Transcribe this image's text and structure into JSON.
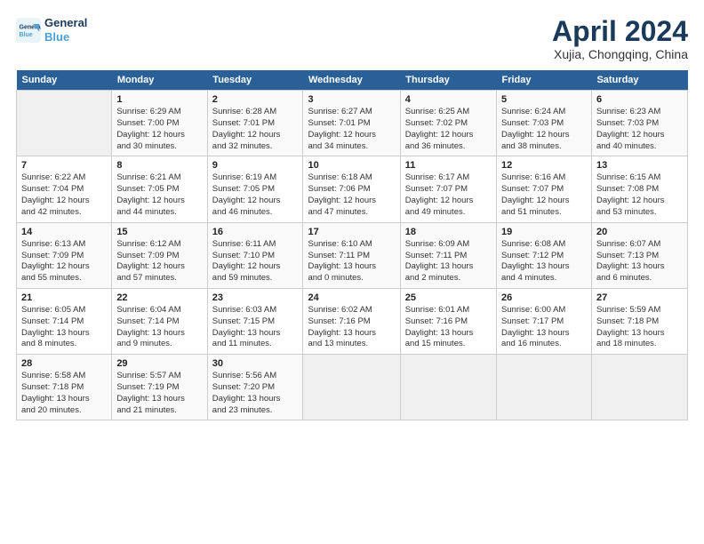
{
  "header": {
    "logo_line1": "General",
    "logo_line2": "Blue",
    "month_title": "April 2024",
    "location": "Xujia, Chongqing, China"
  },
  "weekdays": [
    "Sunday",
    "Monday",
    "Tuesday",
    "Wednesday",
    "Thursday",
    "Friday",
    "Saturday"
  ],
  "weeks": [
    [
      {
        "day": "",
        "info": ""
      },
      {
        "day": "1",
        "info": "Sunrise: 6:29 AM\nSunset: 7:00 PM\nDaylight: 12 hours\nand 30 minutes."
      },
      {
        "day": "2",
        "info": "Sunrise: 6:28 AM\nSunset: 7:01 PM\nDaylight: 12 hours\nand 32 minutes."
      },
      {
        "day": "3",
        "info": "Sunrise: 6:27 AM\nSunset: 7:01 PM\nDaylight: 12 hours\nand 34 minutes."
      },
      {
        "day": "4",
        "info": "Sunrise: 6:25 AM\nSunset: 7:02 PM\nDaylight: 12 hours\nand 36 minutes."
      },
      {
        "day": "5",
        "info": "Sunrise: 6:24 AM\nSunset: 7:03 PM\nDaylight: 12 hours\nand 38 minutes."
      },
      {
        "day": "6",
        "info": "Sunrise: 6:23 AM\nSunset: 7:03 PM\nDaylight: 12 hours\nand 40 minutes."
      }
    ],
    [
      {
        "day": "7",
        "info": "Sunrise: 6:22 AM\nSunset: 7:04 PM\nDaylight: 12 hours\nand 42 minutes."
      },
      {
        "day": "8",
        "info": "Sunrise: 6:21 AM\nSunset: 7:05 PM\nDaylight: 12 hours\nand 44 minutes."
      },
      {
        "day": "9",
        "info": "Sunrise: 6:19 AM\nSunset: 7:05 PM\nDaylight: 12 hours\nand 46 minutes."
      },
      {
        "day": "10",
        "info": "Sunrise: 6:18 AM\nSunset: 7:06 PM\nDaylight: 12 hours\nand 47 minutes."
      },
      {
        "day": "11",
        "info": "Sunrise: 6:17 AM\nSunset: 7:07 PM\nDaylight: 12 hours\nand 49 minutes."
      },
      {
        "day": "12",
        "info": "Sunrise: 6:16 AM\nSunset: 7:07 PM\nDaylight: 12 hours\nand 51 minutes."
      },
      {
        "day": "13",
        "info": "Sunrise: 6:15 AM\nSunset: 7:08 PM\nDaylight: 12 hours\nand 53 minutes."
      }
    ],
    [
      {
        "day": "14",
        "info": "Sunrise: 6:13 AM\nSunset: 7:09 PM\nDaylight: 12 hours\nand 55 minutes."
      },
      {
        "day": "15",
        "info": "Sunrise: 6:12 AM\nSunset: 7:09 PM\nDaylight: 12 hours\nand 57 minutes."
      },
      {
        "day": "16",
        "info": "Sunrise: 6:11 AM\nSunset: 7:10 PM\nDaylight: 12 hours\nand 59 minutes."
      },
      {
        "day": "17",
        "info": "Sunrise: 6:10 AM\nSunset: 7:11 PM\nDaylight: 13 hours\nand 0 minutes."
      },
      {
        "day": "18",
        "info": "Sunrise: 6:09 AM\nSunset: 7:11 PM\nDaylight: 13 hours\nand 2 minutes."
      },
      {
        "day": "19",
        "info": "Sunrise: 6:08 AM\nSunset: 7:12 PM\nDaylight: 13 hours\nand 4 minutes."
      },
      {
        "day": "20",
        "info": "Sunrise: 6:07 AM\nSunset: 7:13 PM\nDaylight: 13 hours\nand 6 minutes."
      }
    ],
    [
      {
        "day": "21",
        "info": "Sunrise: 6:05 AM\nSunset: 7:14 PM\nDaylight: 13 hours\nand 8 minutes."
      },
      {
        "day": "22",
        "info": "Sunrise: 6:04 AM\nSunset: 7:14 PM\nDaylight: 13 hours\nand 9 minutes."
      },
      {
        "day": "23",
        "info": "Sunrise: 6:03 AM\nSunset: 7:15 PM\nDaylight: 13 hours\nand 11 minutes."
      },
      {
        "day": "24",
        "info": "Sunrise: 6:02 AM\nSunset: 7:16 PM\nDaylight: 13 hours\nand 13 minutes."
      },
      {
        "day": "25",
        "info": "Sunrise: 6:01 AM\nSunset: 7:16 PM\nDaylight: 13 hours\nand 15 minutes."
      },
      {
        "day": "26",
        "info": "Sunrise: 6:00 AM\nSunset: 7:17 PM\nDaylight: 13 hours\nand 16 minutes."
      },
      {
        "day": "27",
        "info": "Sunrise: 5:59 AM\nSunset: 7:18 PM\nDaylight: 13 hours\nand 18 minutes."
      }
    ],
    [
      {
        "day": "28",
        "info": "Sunrise: 5:58 AM\nSunset: 7:18 PM\nDaylight: 13 hours\nand 20 minutes."
      },
      {
        "day": "29",
        "info": "Sunrise: 5:57 AM\nSunset: 7:19 PM\nDaylight: 13 hours\nand 21 minutes."
      },
      {
        "day": "30",
        "info": "Sunrise: 5:56 AM\nSunset: 7:20 PM\nDaylight: 13 hours\nand 23 minutes."
      },
      {
        "day": "",
        "info": ""
      },
      {
        "day": "",
        "info": ""
      },
      {
        "day": "",
        "info": ""
      },
      {
        "day": "",
        "info": ""
      }
    ]
  ]
}
